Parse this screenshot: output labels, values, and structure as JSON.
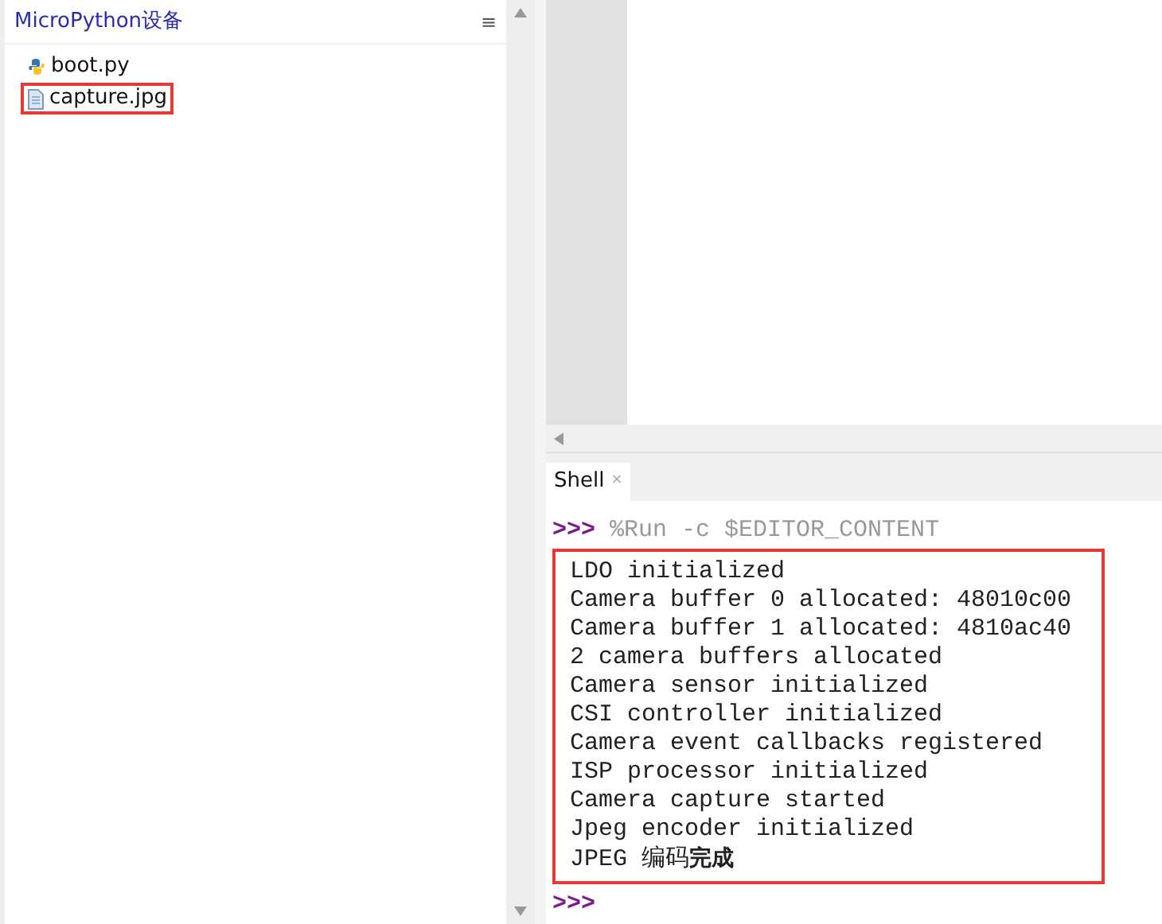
{
  "files_panel": {
    "title": "MicroPython设备",
    "menu_glyph": "≡",
    "files": [
      {
        "name": "boot.py",
        "kind": "python",
        "highlighted": false
      },
      {
        "name": "capture.jpg",
        "kind": "file",
        "highlighted": true
      }
    ]
  },
  "shell": {
    "tab": {
      "label": "Shell",
      "close": "×",
      "selected": true
    },
    "prompt": ">>>",
    "command": "%Run -c $EDITOR_CONTENT",
    "output": {
      "highlighted": true,
      "lines": [
        "LDO initialized",
        "Camera buffer 0 allocated: 48010c00",
        "Camera buffer 1 allocated: 4810ac40",
        "2 camera buffers allocated",
        "Camera sensor initialized",
        "CSI controller initialized",
        "Camera event callbacks registered",
        "ISP processor initialized",
        "Camera capture started",
        "Jpeg encoder initialized",
        "JPEG 编码**完成**"
      ]
    },
    "final_prompt": ">>>"
  }
}
